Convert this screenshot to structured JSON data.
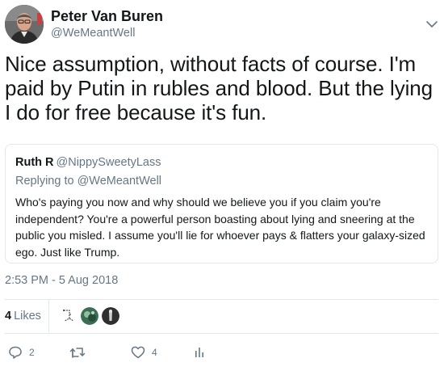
{
  "tweet": {
    "author_name": "Peter Van Buren",
    "author_handle": "@WeMeantWell",
    "text": "Nice assumption, without facts of course. I'm paid by Putin in rubles and blood. But the lying I do for free because it's fun.",
    "timestamp": "2:53 PM - 5 Aug 2018"
  },
  "quoted_tweet": {
    "author_name": "Ruth R",
    "author_handle": "@NippySweetyLass",
    "replying_to_prefix": "Replying to",
    "replying_to_handle": "@WeMeantWell",
    "text": "Who's paying you now and why should we believe you if you claim you're independent? You're a powerful person boasting about lying and sneering at the public you misled. I assume you'll lie for whoever pays & flatters your galaxy-sized ego.  Just like Trump."
  },
  "stats": {
    "likes_count": "4",
    "likes_label": "Likes"
  },
  "actions": {
    "reply_count": "2",
    "retweet_count": "",
    "like_count": "4"
  },
  "icons": {
    "caret": "chevron-down-icon",
    "reply": "reply-icon",
    "retweet": "retweet-icon",
    "like": "heart-icon",
    "analytics": "analytics-icon"
  },
  "colors": {
    "text": "#14171a",
    "secondary": "#657786",
    "border": "#e1e8ed",
    "icon": "#657786"
  }
}
